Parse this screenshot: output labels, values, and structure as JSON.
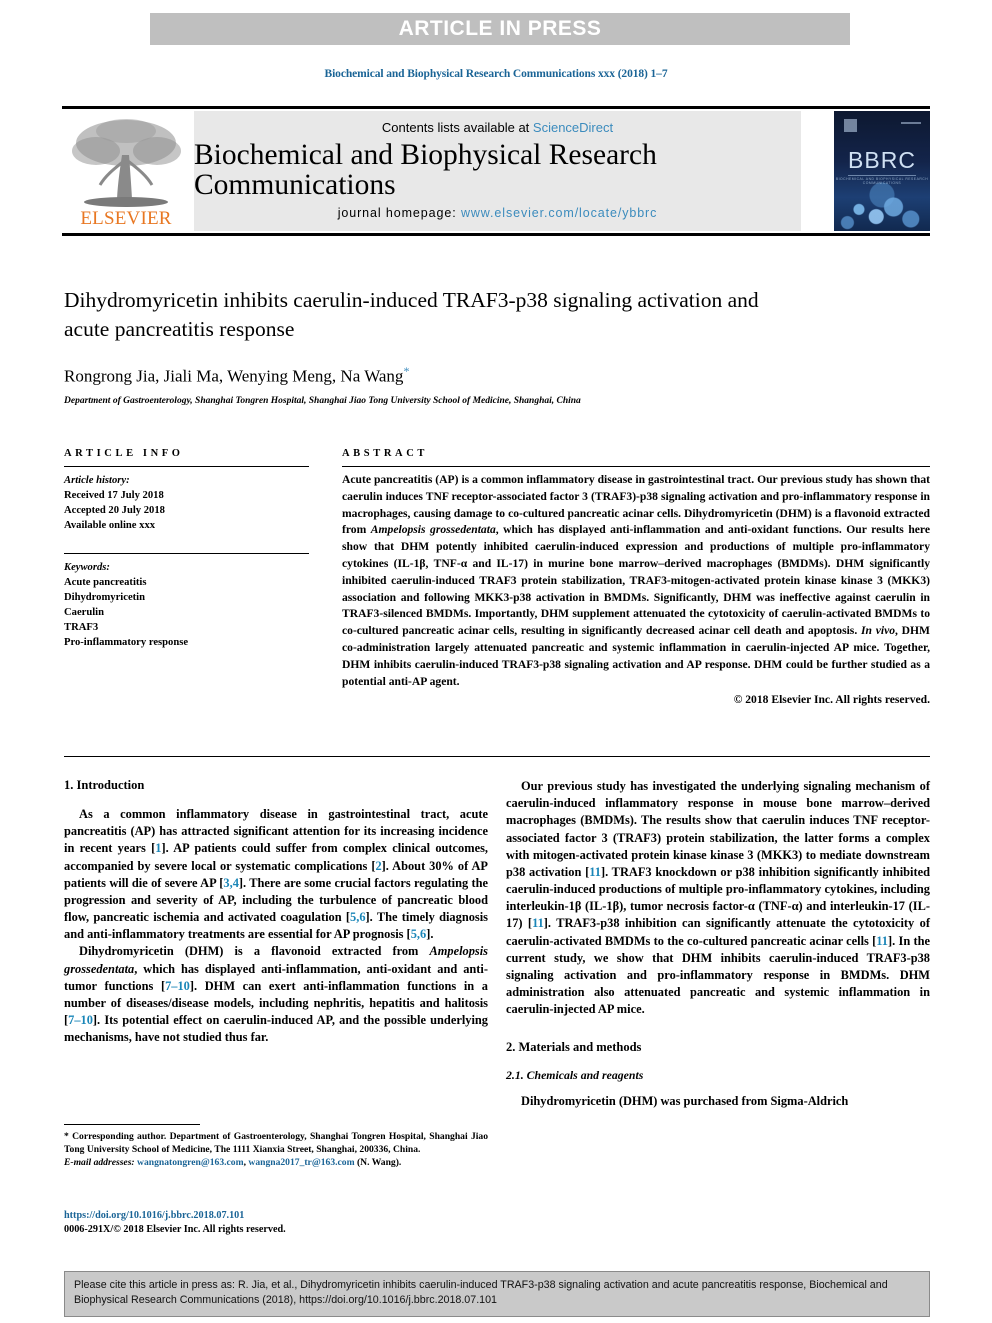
{
  "banner": {
    "text": "ARTICLE IN PRESS"
  },
  "running_head": "Biochemical and Biophysical Research Communications xxx (2018) 1–7",
  "masthead": {
    "publisher": "ELSEVIER",
    "contents_prefix": "Contents lists available at ",
    "contents_link": "ScienceDirect",
    "journal_name": "Biochemical and Biophysical Research Communications",
    "homepage_label": "journal homepage: ",
    "homepage_url": "www.elsevier.com/locate/ybbrc",
    "cover_title": "BBRC",
    "cover_subtitle": "BIOCHEMICAL AND BIOPHYSICAL RESEARCH COMMUNICATIONS"
  },
  "article": {
    "title": "Dihydromyricetin inhibits caerulin-induced TRAF3-p38 signaling activation and acute pancreatitis response",
    "authors": "Rongrong Jia, Jiali Ma, Wenying Meng, Na Wang",
    "corresponding_marker": "*",
    "affiliation": "Department of Gastroenterology, Shanghai Tongren Hospital, Shanghai Jiao Tong University School of Medicine, Shanghai, China"
  },
  "article_info": {
    "heading": "ARTICLE INFO",
    "history_label": "Article history:",
    "history": [
      "Received 17 July 2018",
      "Accepted 20 July 2018",
      "Available online xxx"
    ],
    "keywords_label": "Keywords:",
    "keywords": [
      "Acute pancreatitis",
      "Dihydromyricetin",
      "Caerulin",
      "TRAF3",
      "Pro-inflammatory response"
    ]
  },
  "abstract": {
    "heading": "ABSTRACT",
    "p1_a": "Acute pancreatitis (AP) is a common inflammatory disease in gastrointestinal tract. Our previous study has shown that caerulin induces TNF receptor-associated factor 3 (TRAF3)-p38 signaling activation and pro-inflammatory response in macrophages, causing damage to co-cultured pancreatic acinar cells. Dihydromyricetin (DHM) is a flavonoid extracted from ",
    "p1_italic": "Ampelopsis grossedentata",
    "p1_b": ", which has displayed anti-inflammation and anti-oxidant functions. Our results here show that DHM potently inhibited caerulin-induced expression and productions of multiple pro-inflammatory cytokines (IL-1β, TNF-α and IL-17) in murine bone marrow–derived macrophages (BMDMs). DHM significantly inhibited caerulin-induced TRAF3 protein stabilization, TRAF3-mitogen-activated protein kinase kinase 3 (MKK3) association and following MKK3-p38 activation in BMDMs. Significantly, DHM was ineffective against caerulin in TRAF3-silenced BMDMs. Importantly, DHM supplement attenuated the cytotoxicity of caerulin-activated BMDMs to co-cultured pancreatic acinar cells, resulting in significantly decreased acinar cell death and apoptosis. ",
    "p1_italic2": "In vivo",
    "p1_c": ", DHM co-administration largely attenuated pancreatic and systemic inflammation in caerulin-injected AP mice. Together, DHM inhibits caerulin-induced TRAF3-p38 signaling activation and AP response. DHM could be further studied as a potential anti-AP agent.",
    "copyright": "© 2018 Elsevier Inc. All rights reserved."
  },
  "body": {
    "intro_heading": "1. Introduction",
    "intro_p1_a": "As a common inflammatory disease in gastrointestinal tract, acute pancreatitis (AP) has attracted significant attention for its increasing incidence in recent years [",
    "intro_ref1": "1",
    "intro_p1_b": "]. AP patients could suffer from complex clinical outcomes, accompanied by severe local or systematic complications [",
    "intro_ref2": "2",
    "intro_p1_c": "]. About 30% of AP patients will die of severe AP [",
    "intro_ref3": "3,4",
    "intro_p1_d": "]. There are some crucial factors regulating the progression and severity of AP, including the turbulence of pancreatic blood flow, pancreatic ischemia and activated coagulation [",
    "intro_ref4": "5,6",
    "intro_p1_e": "]. The timely diagnosis and anti-inflammatory treatments are essential for AP prognosis [",
    "intro_ref5": "5,6",
    "intro_p1_f": "].",
    "intro_p2_a": "Dihydromyricetin (DHM) is a flavonoid extracted from ",
    "intro_p2_italic": "Ampelopsis grossedentata",
    "intro_p2_b": ", which has displayed anti-inflammation, anti-oxidant and anti-tumor functions [",
    "intro_ref6": "7–10",
    "intro_p2_c": "]. DHM can exert anti-inflammation functions in a number of diseases/disease models, including nephritis, hepatitis and halitosis [",
    "intro_ref7": "7–10",
    "intro_p2_d": "]. Its potential effect on caerulin-induced AP, and the possible underlying mechanisms, have not studied thus far.",
    "right_p1_a": "Our previous study has investigated the underlying signaling mechanism of caerulin-induced inflammatory response in mouse bone marrow–derived macrophages (BMDMs). The results show that caerulin induces TNF receptor-associated factor 3 (TRAF3) protein stabilization, the latter forms a complex with mitogen-activated protein kinase kinase 3 (MKK3) to mediate downstream p38 activation [",
    "right_ref1": "11",
    "right_p1_b": "]. TRAF3 knockdown or p38 inhibition significantly inhibited caerulin-induced productions of multiple pro-inflammatory cytokines, including interleukin-1β (IL-1β), tumor necrosis factor-α (TNF-α) and interleukin-17 (IL-17) [",
    "right_ref2": "11",
    "right_p1_c": "]. TRAF3-p38 inhibition can significantly attenuate the cytotoxicity of caerulin-activated BMDMs to the co-cultured pancreatic acinar cells [",
    "right_ref3": "11",
    "right_p1_d": "]. In the current study, we show that DHM inhibits caerulin-induced TRAF3-p38 signaling activation and pro-inflammatory response in BMDMs. DHM administration also attenuated pancreatic and systemic inflammation in caerulin-injected AP mice.",
    "methods_heading": "2. Materials and methods",
    "methods_sub_heading": "2.1. Chemicals and reagents",
    "methods_p1": "Dihydromyricetin (DHM) was purchased from Sigma-Aldrich"
  },
  "footnote": {
    "corresponding_a": "* Corresponding author. Department of Gastroenterology, Shanghai Tongren Hospital, Shanghai Jiao Tong University School of Medicine, The 1111 Xianxia Street, Shanghai, 200336, China.",
    "email_label": "E-mail addresses:",
    "email1": "wangnatongren@163.com",
    "email_sep": ", ",
    "email2": "wangna2017_tr@163.com",
    "email_suffix": " (N. Wang).",
    "doi_url": "https://doi.org/10.1016/j.bbrc.2018.07.101",
    "issn_line": "0006-291X/© 2018 Elsevier Inc. All rights reserved."
  },
  "citation_box": {
    "text": "Please cite this article in press as: R. Jia, et al., Dihydromyricetin inhibits caerulin-induced TRAF3-p38 signaling activation and acute pancreatitis response, Biochemical and Biophysical Research Communications (2018), https://doi.org/10.1016/j.bbrc.2018.07.101"
  },
  "colors": {
    "banner_bg": "#bfbfbf",
    "link_blue": "#3b8bbd",
    "ref_blue": "#1a86b8",
    "elsevier_orange": "#e87722",
    "cite_box_bg": "#c9c9c9"
  }
}
